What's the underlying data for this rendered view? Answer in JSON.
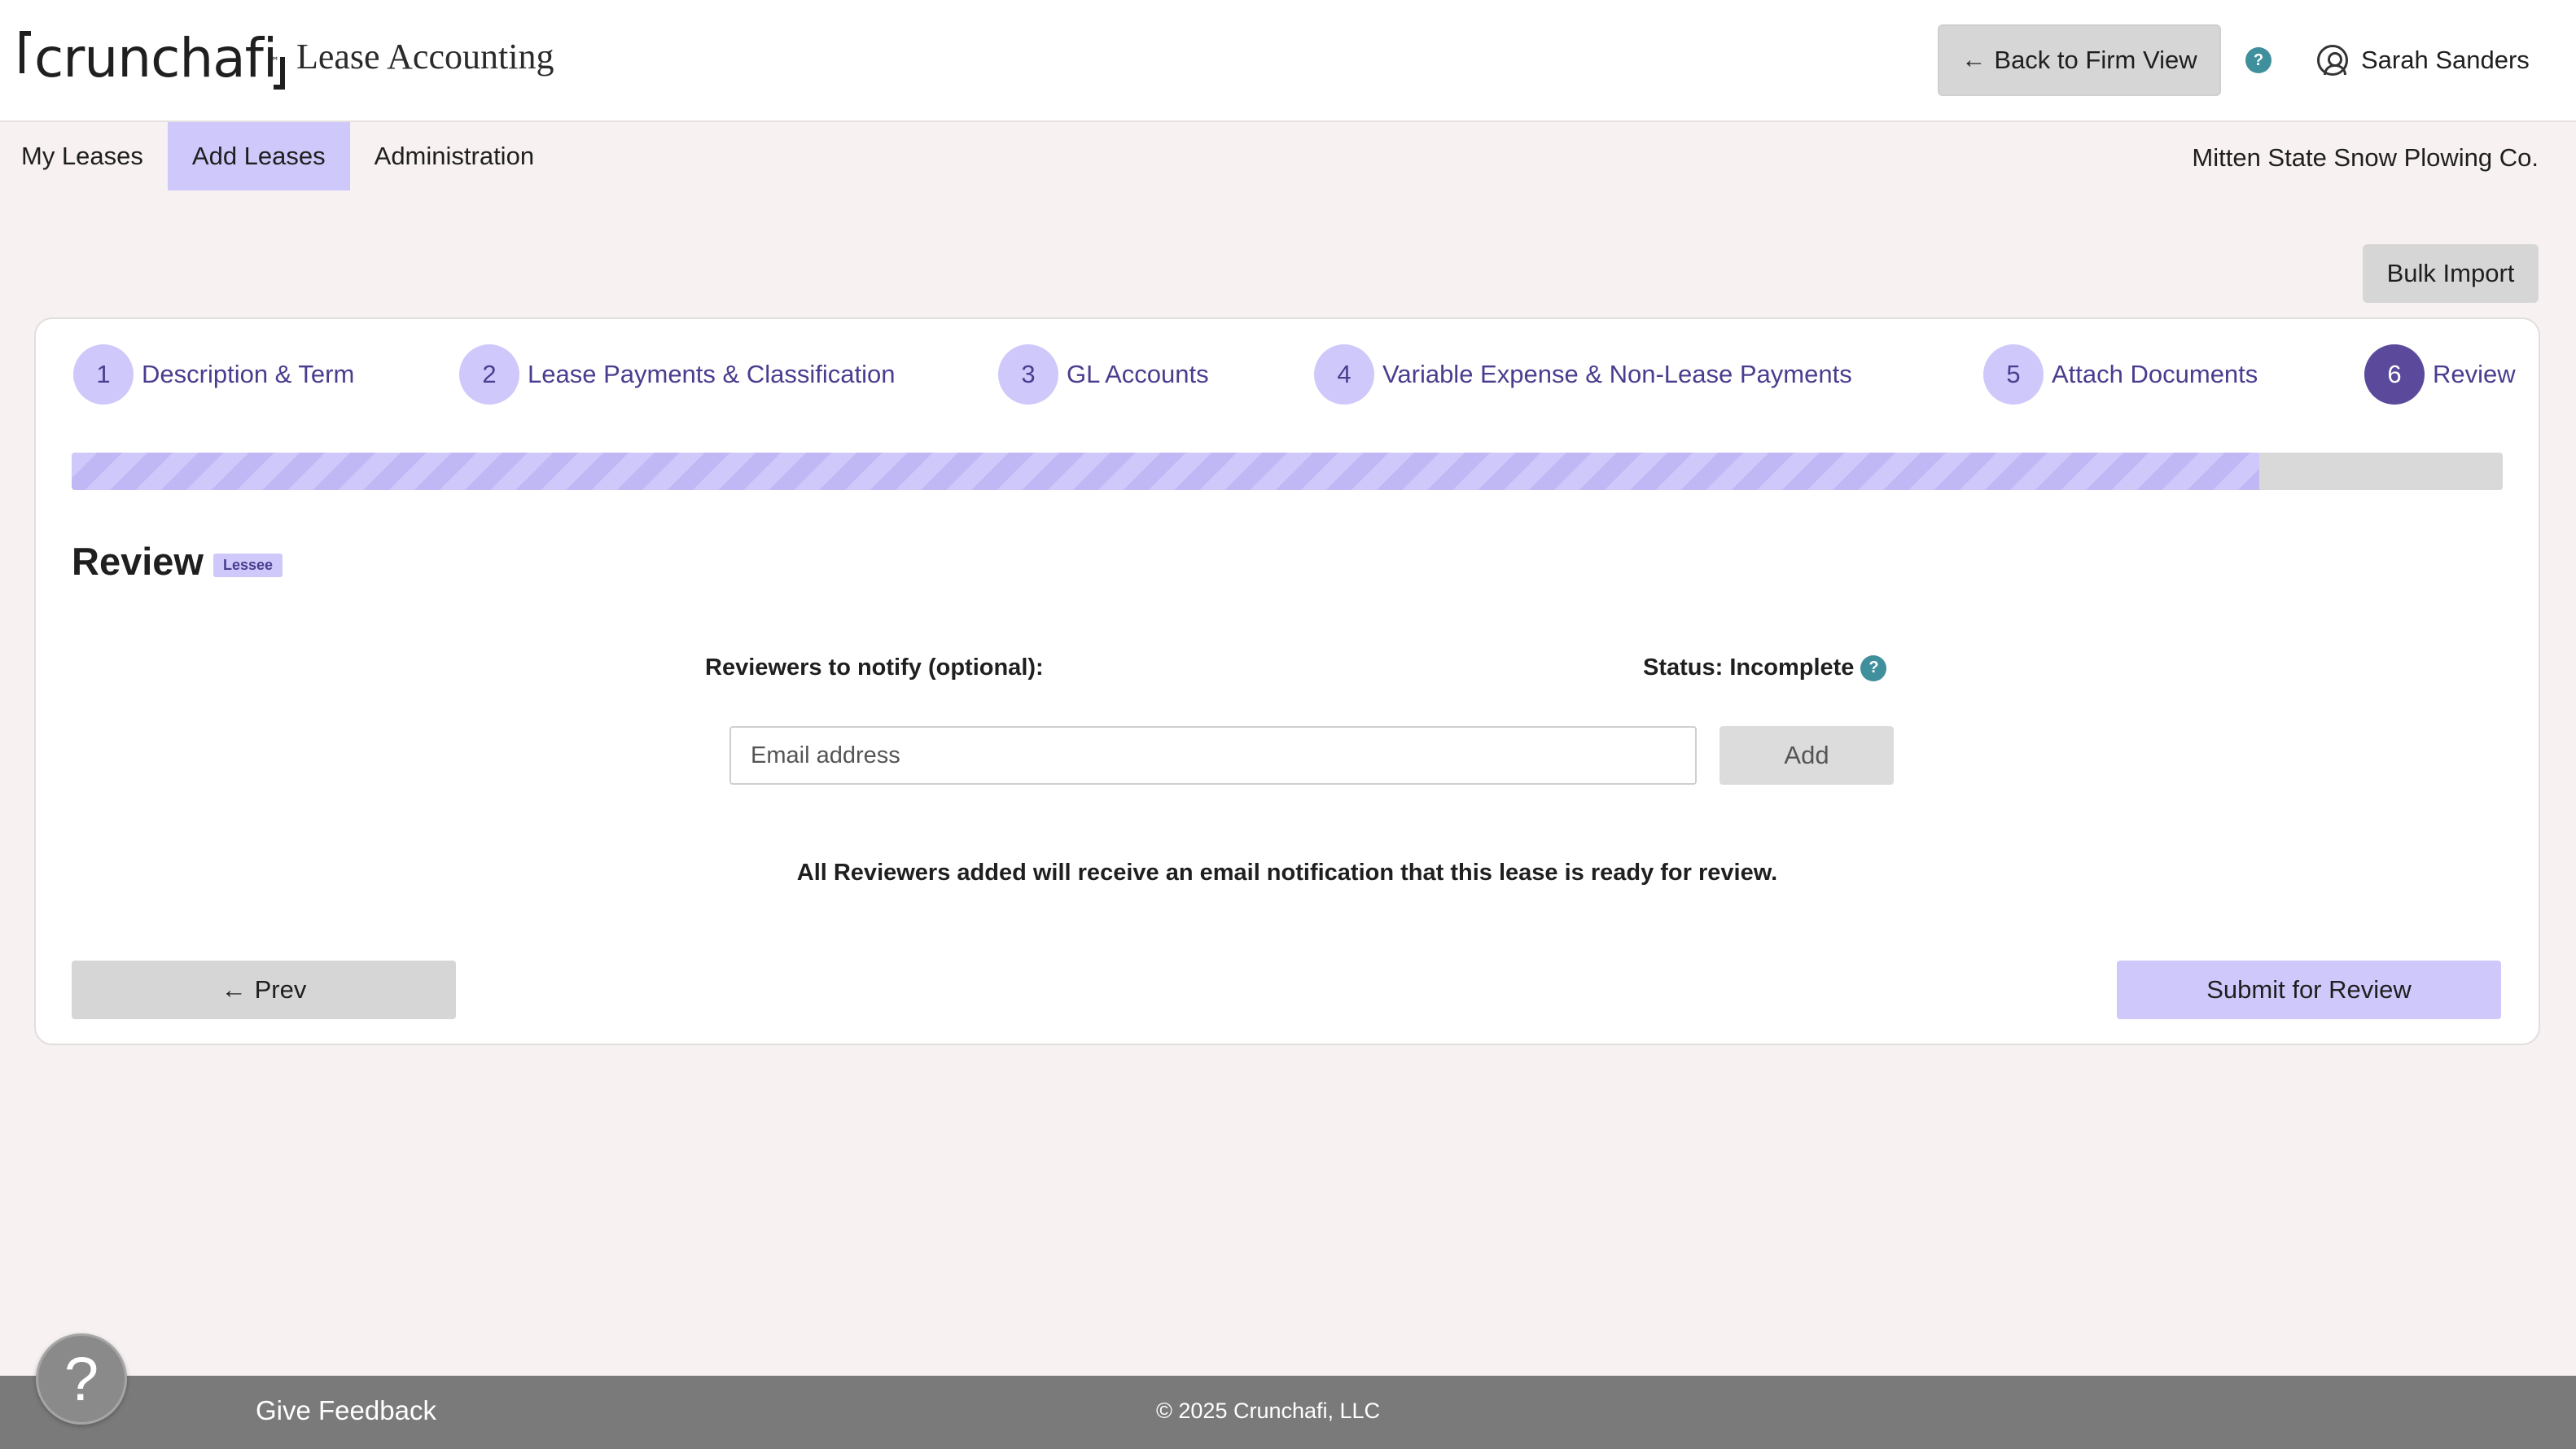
{
  "header": {
    "logo_text": "crunchafi",
    "logo_tm": "™",
    "product_name": "Lease Accounting",
    "back_button_label": "Back to Firm View",
    "help_glyph": "?",
    "user_name": "Sarah Sanders"
  },
  "nav": {
    "items": [
      {
        "label": "My Leases",
        "active": false
      },
      {
        "label": "Add Leases",
        "active": true
      },
      {
        "label": "Administration",
        "active": false
      }
    ],
    "company_name": "Mitten State Snow Plowing Co."
  },
  "bulk_import_label": "Bulk Import",
  "steps": [
    {
      "num": "1",
      "label": "Description & Term"
    },
    {
      "num": "2",
      "label": "Lease Payments & Classification"
    },
    {
      "num": "3",
      "label": "GL Accounts"
    },
    {
      "num": "4",
      "label": "Variable Expense & Non-Lease Payments"
    },
    {
      "num": "5",
      "label": "Attach Documents"
    },
    {
      "num": "6",
      "label": "Review",
      "current": true
    }
  ],
  "progress_fraction": 0.9,
  "review": {
    "title": "Review",
    "badge": "Lessee",
    "reviewers_label": "Reviewers to notify (optional):",
    "status_label": "Status: Incomplete",
    "status_help_glyph": "?",
    "email_placeholder": "Email address",
    "add_label": "Add",
    "notice": "All Reviewers added will receive an email notification that this lease is ready for review.",
    "prev_label": "Prev",
    "submit_label": "Submit for Review"
  },
  "footer": {
    "give_feedback": "Give Feedback",
    "copyright": "©  2025 Crunchafi, LLC",
    "help_fab_glyph": "?"
  },
  "colors": {
    "accent": "#cfc8fb",
    "accent_dark": "#5b4a9c",
    "help_teal": "#3f8f9c",
    "footer": "#7a7a7a"
  }
}
